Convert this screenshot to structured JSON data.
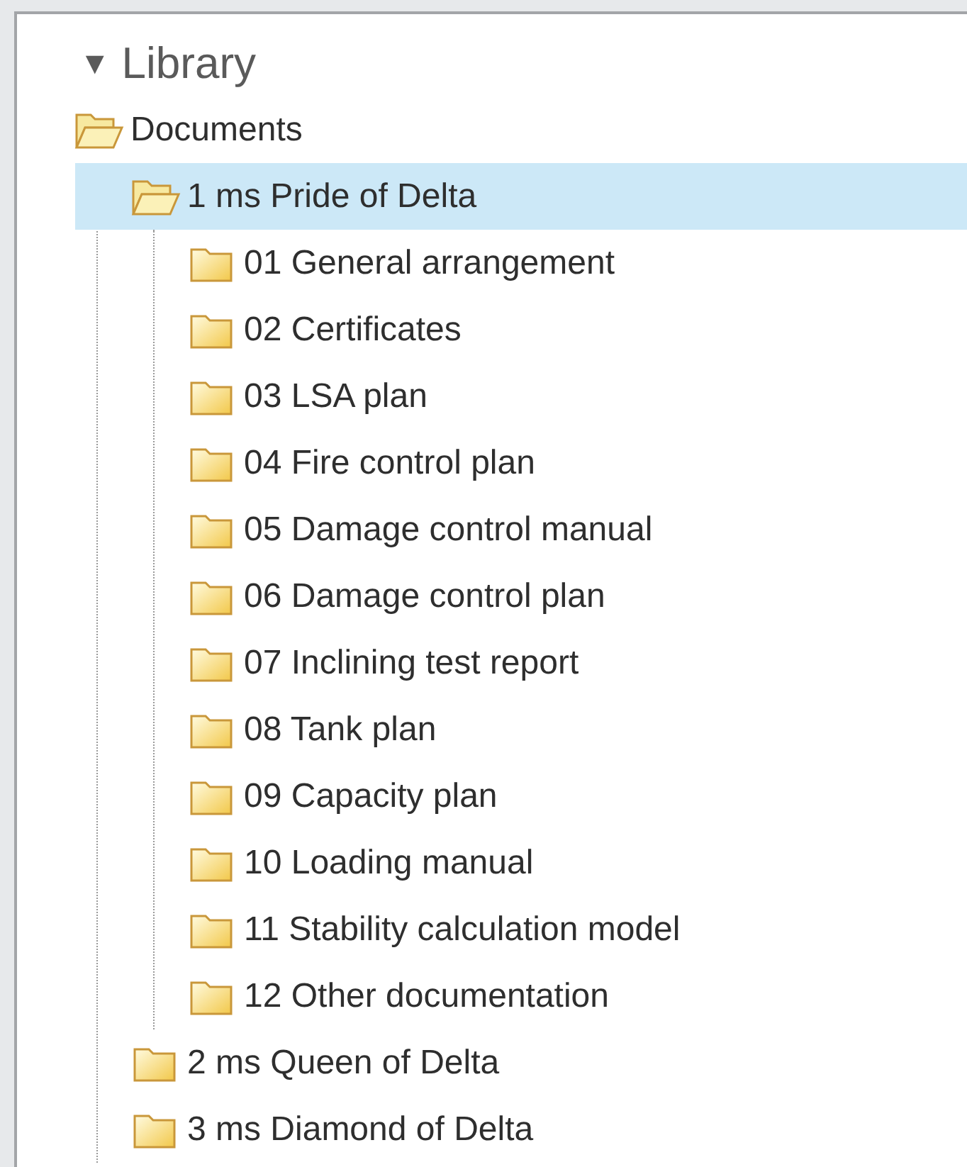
{
  "library": {
    "toggle": "▼",
    "title": "Library",
    "expanded": true
  },
  "tree": [
    {
      "label": "Documents",
      "expanded": true,
      "selected": false,
      "children": [
        {
          "label": "1 ms Pride of Delta",
          "expanded": true,
          "selected": true,
          "children": [
            {
              "label": "01 General arrangement",
              "expanded": false,
              "selected": false
            },
            {
              "label": "02 Certificates",
              "expanded": false,
              "selected": false
            },
            {
              "label": "03 LSA plan",
              "expanded": false,
              "selected": false
            },
            {
              "label": "04 Fire control plan",
              "expanded": false,
              "selected": false
            },
            {
              "label": "05 Damage control manual",
              "expanded": false,
              "selected": false
            },
            {
              "label": "06 Damage control plan",
              "expanded": false,
              "selected": false
            },
            {
              "label": "07 Inclining test report",
              "expanded": false,
              "selected": false
            },
            {
              "label": "08 Tank plan",
              "expanded": false,
              "selected": false
            },
            {
              "label": "09 Capacity plan",
              "expanded": false,
              "selected": false
            },
            {
              "label": "10 Loading manual",
              "expanded": false,
              "selected": false
            },
            {
              "label": "11 Stability calculation model",
              "expanded": false,
              "selected": false
            },
            {
              "label": "12 Other documentation",
              "expanded": false,
              "selected": false
            }
          ]
        },
        {
          "label": "2 ms Queen of Delta",
          "expanded": false,
          "selected": false
        },
        {
          "label": "3 ms Diamond of Delta",
          "expanded": false,
          "selected": false
        }
      ]
    }
  ]
}
